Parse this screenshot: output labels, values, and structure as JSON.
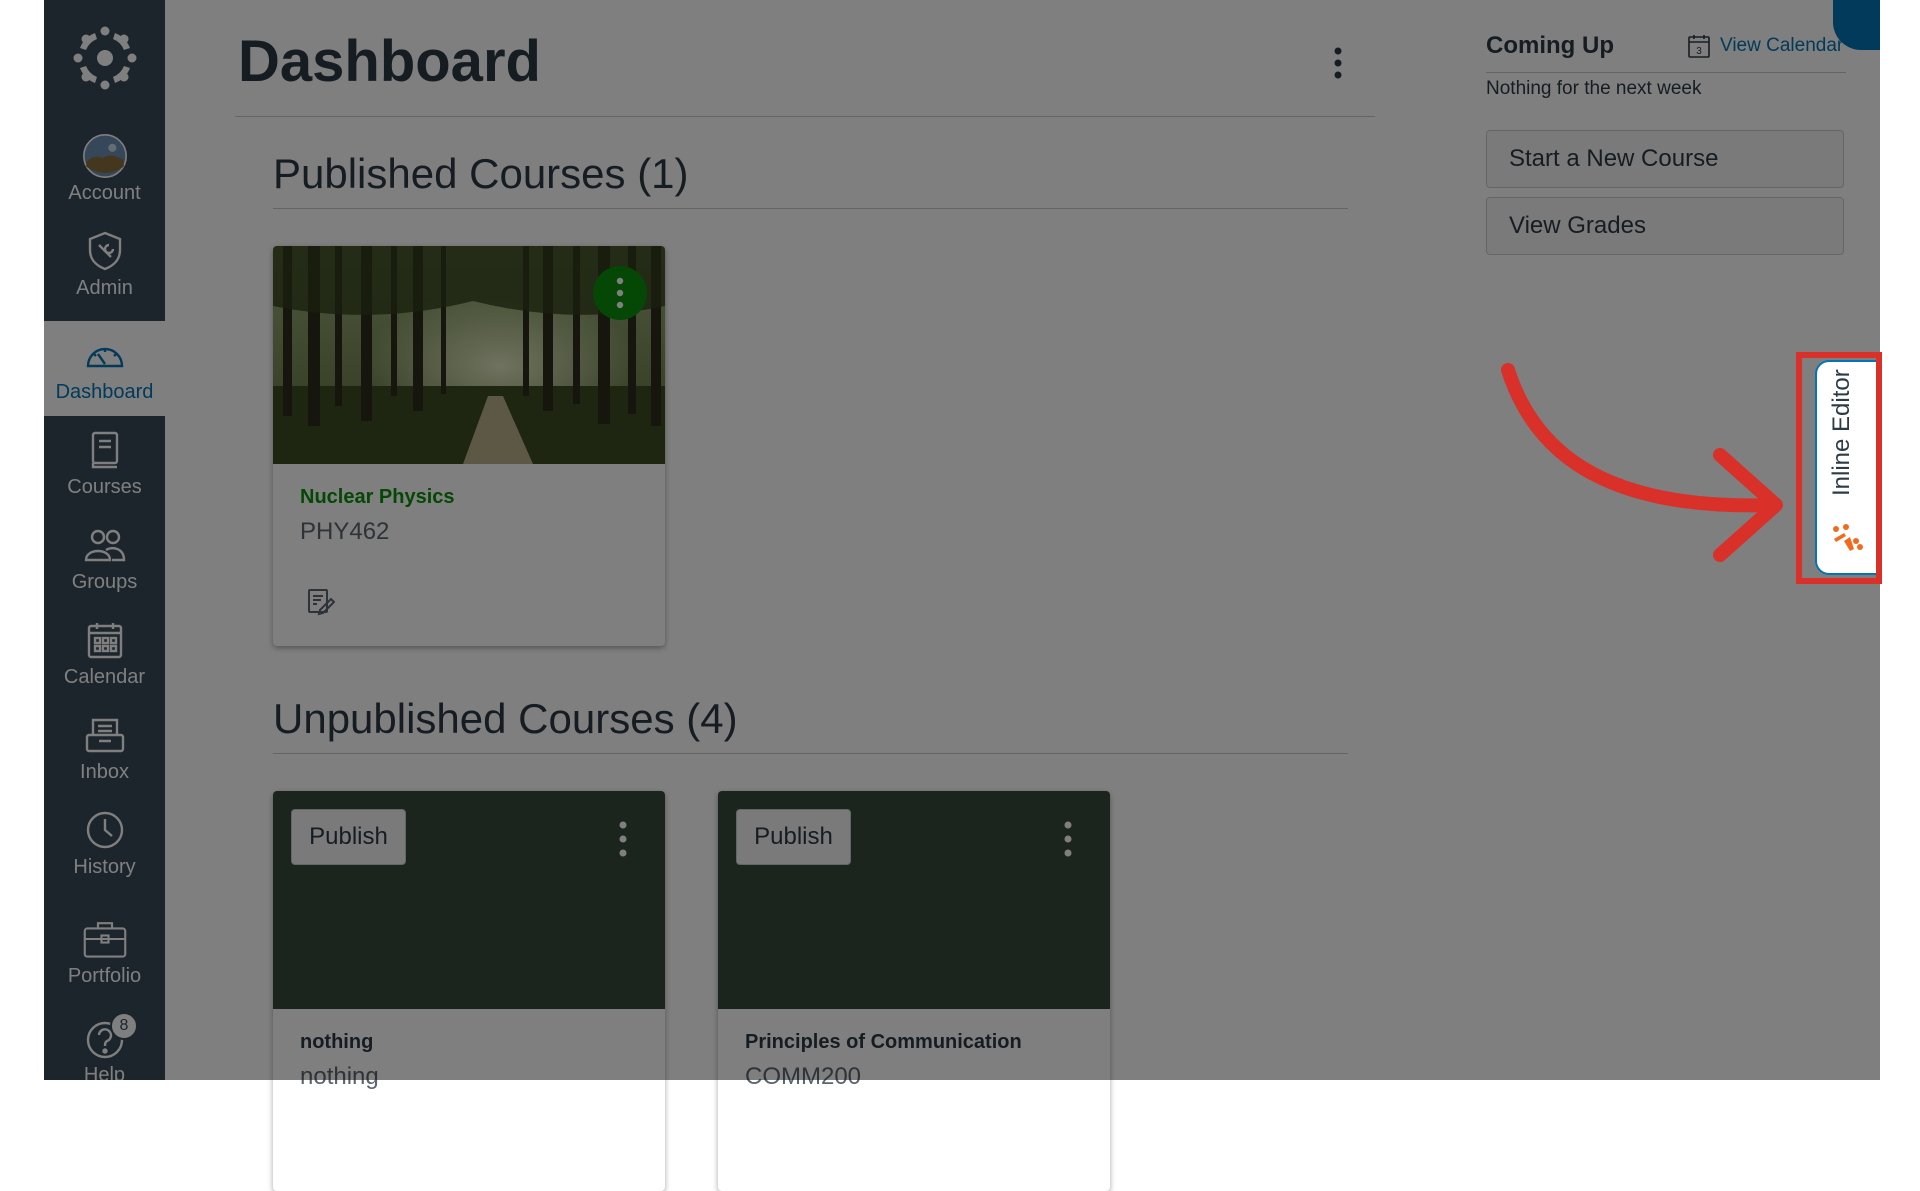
{
  "nav": {
    "account": "Account",
    "admin": "Admin",
    "dashboard": "Dashboard",
    "courses": "Courses",
    "groups": "Groups",
    "calendar": "Calendar",
    "inbox": "Inbox",
    "history": "History",
    "portfolio": "Portfolio",
    "help": "Help",
    "help_badge": "8"
  },
  "page": {
    "title": "Dashboard"
  },
  "published": {
    "title": "Published Courses (1)",
    "courses": [
      {
        "name": "Nuclear Physics",
        "code": "PHY462",
        "color": "#0B8E0B"
      }
    ]
  },
  "unpublished": {
    "title": "Unpublished Courses (4)",
    "publish_label": "Publish",
    "courses": [
      {
        "name": "nothing",
        "code": "nothing"
      },
      {
        "name": "Principles of Communication",
        "code": "COMM200"
      }
    ]
  },
  "sidebar": {
    "coming_up": "Coming Up",
    "view_calendar": "View Calendar",
    "calendar_day": "3",
    "nothing_week": "Nothing for the next week",
    "start_course": "Start a New Course",
    "view_grades": "View Grades"
  },
  "inline_editor": {
    "label": "Inline Editor"
  },
  "colors": {
    "nav_bg": "#394B58",
    "accent": "#0374B5",
    "highlight": "#D9302A",
    "course_green": "#0B8E0B",
    "logo_orange": "#F26B1D"
  }
}
